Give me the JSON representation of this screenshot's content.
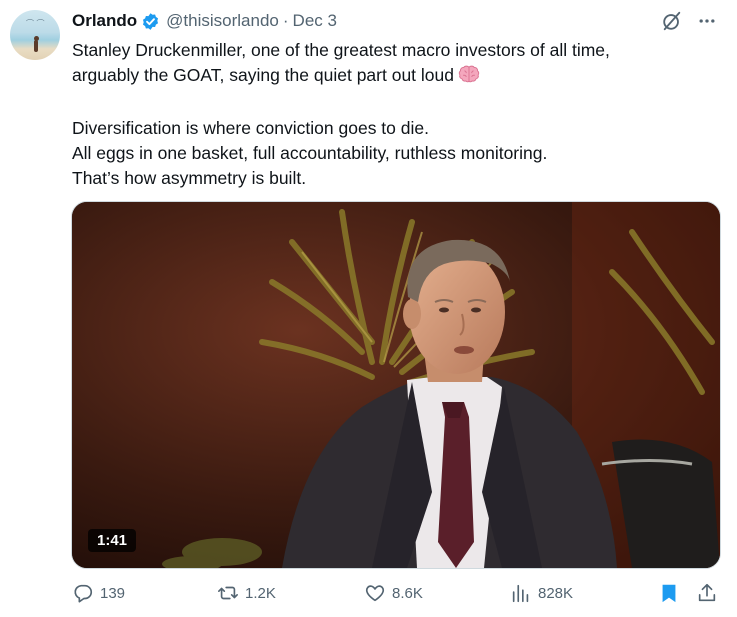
{
  "tweet": {
    "author_name": "Orlando",
    "handle": "@thisisorlando",
    "separator": "·",
    "date": "Dec 3",
    "lines": [
      "Stanley Druckenmiller, one of the greatest macro investors of all time,",
      "arguably the GOAT, saying the quiet part out loud"
    ],
    "paragraph2": [
      "Diversification is where conviction goes to die.",
      "All eggs in one basket, full accountability, ruthless monitoring.",
      "That’s how asymmetry is built."
    ],
    "emoji": "brain"
  },
  "media": {
    "duration": "1:41"
  },
  "actions": {
    "replies": "139",
    "reposts": "1.2K",
    "likes": "8.6K",
    "views": "828K"
  },
  "colors": {
    "text": "#0f1419",
    "secondary": "#536471",
    "verified_blue": "#1d9bf0",
    "bookmark_blue": "#1d9bf0"
  }
}
